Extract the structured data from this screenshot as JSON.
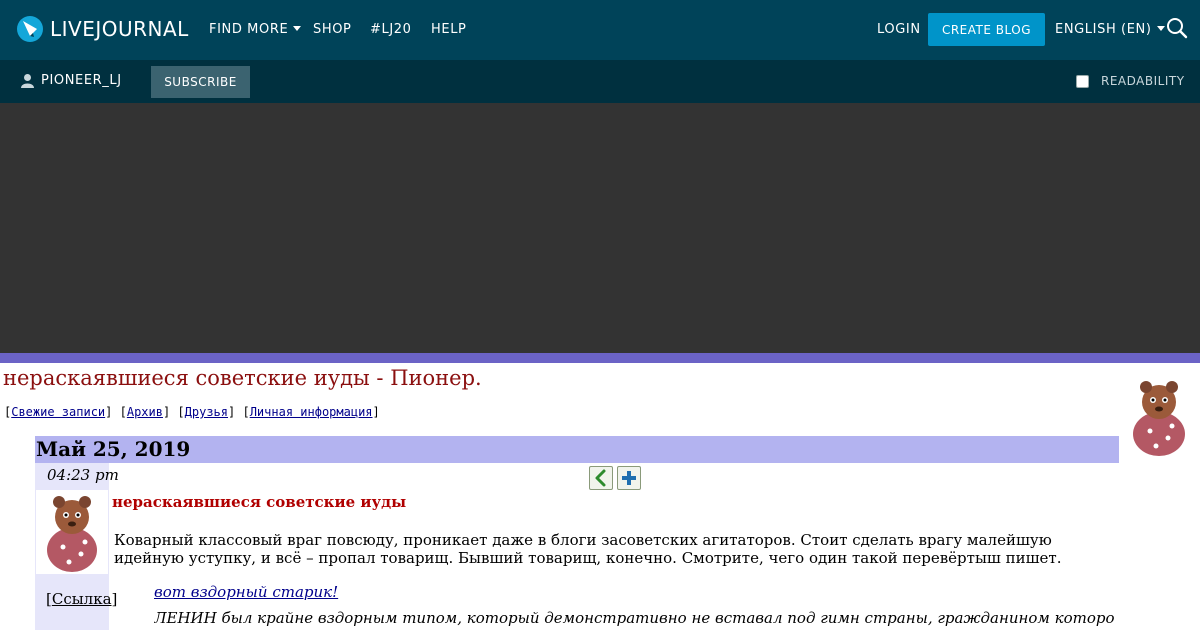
{
  "header": {
    "logo_text": "LIVEJOURNAL",
    "nav": {
      "find_more": "FIND MORE",
      "shop": "SHOP",
      "lj20": "#LJ20",
      "help": "HELP"
    },
    "login": "LOGIN",
    "create_blog": "CREATE BLOG",
    "language": "ENGLISH (EN)"
  },
  "subbar": {
    "username": "PIONEER_LJ",
    "subscribe": "SUBSCRIBE",
    "readability": "READABILITY"
  },
  "journal": {
    "title": "нераскаявшиеся советские иуды - Пионер.",
    "nav": [
      "Свежие записи",
      "Архив",
      "Друзья",
      "Личная информация"
    ]
  },
  "entry": {
    "date": "Май 25, 2019",
    "time": "04:23 pm",
    "subject": "нераскаявшиеся советские иуды",
    "body": "Коварный классовый враг повсюду, проникает даже в блоги засоветских агитаторов. Стоит сделать врагу малейшую идейную уступку, и всё – пропал товарищ. Бывший товарищ, конечно. Смотрите, чего один такой перевёртыш пишет.",
    "quote_link": "вот вздорный старик!",
    "quote_text": "ЛЕНИН был крайне вздорным типом, который демонстративно не вставал под гимн страны, гражданином которой он был, но при этом",
    "link_label": "Ссылка"
  },
  "colors": {
    "topbar": "#004359",
    "subbar": "#00303f",
    "create_blog": "#0094c9",
    "date_bar": "#b3b3f0",
    "title_red": "#8b0f0f"
  }
}
